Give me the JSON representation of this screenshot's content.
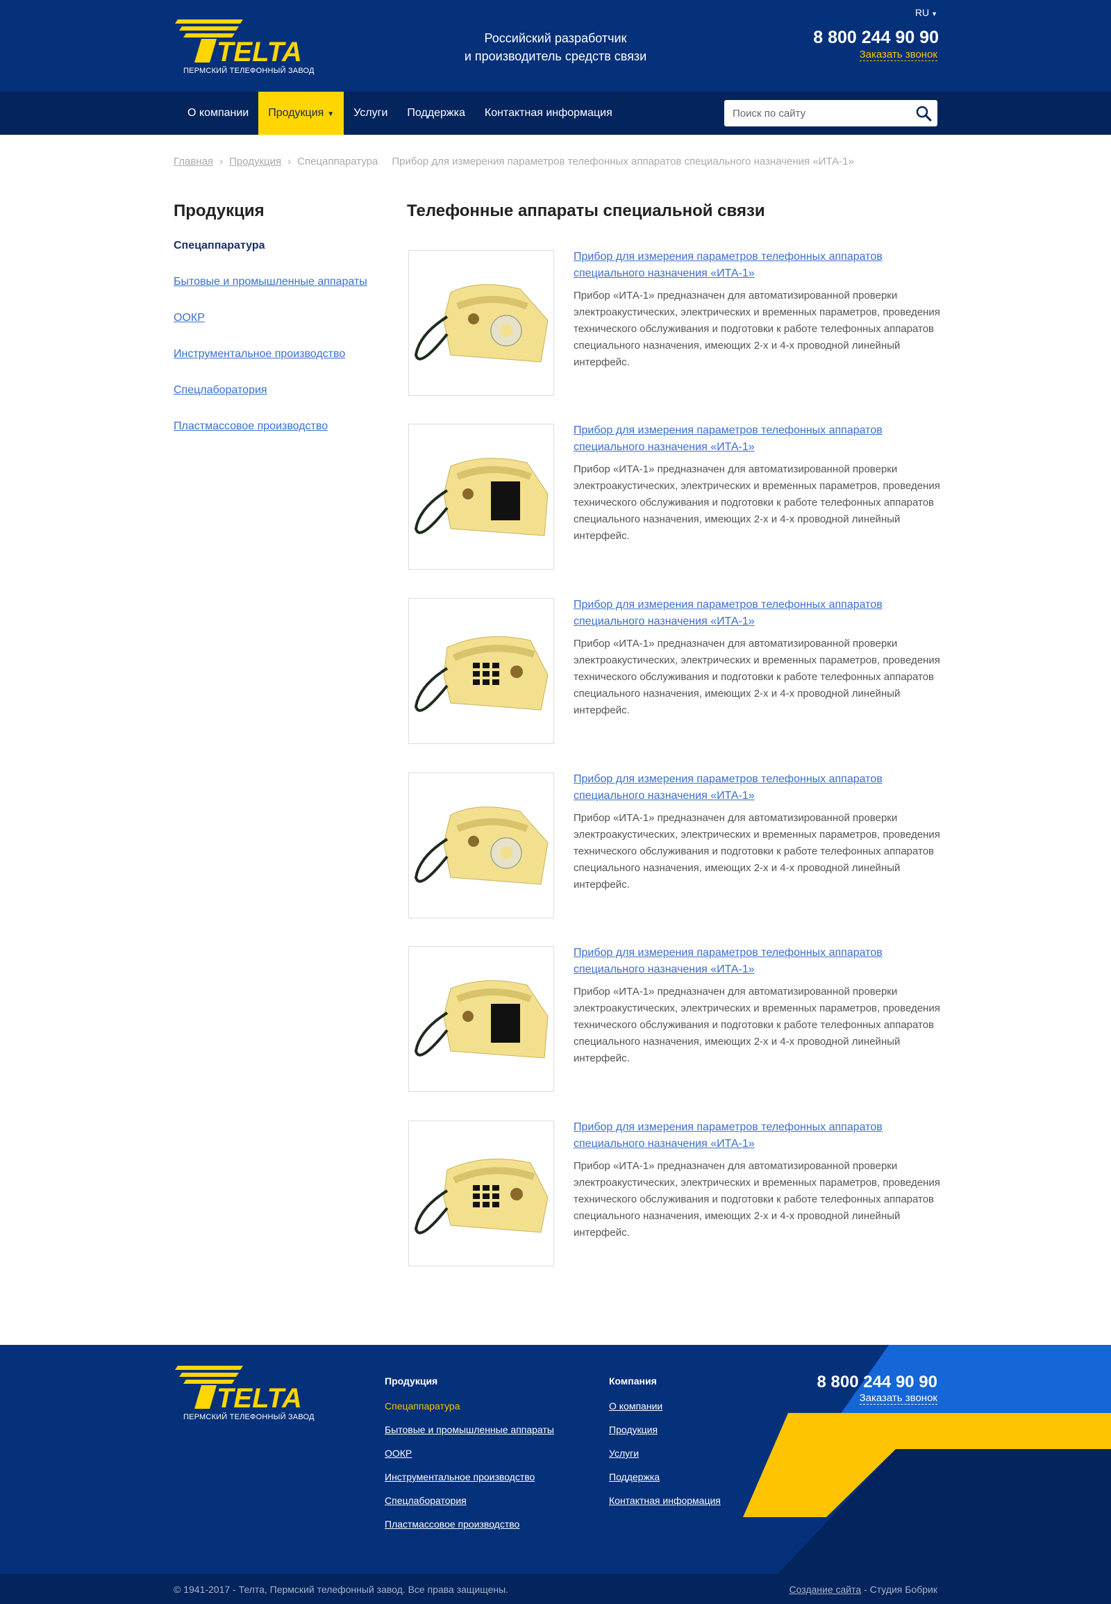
{
  "header": {
    "logo_text": "TELTA",
    "logo_sub": "ПЕРМСКИЙ ТЕЛЕФОННЫЙ ЗАВОД",
    "tagline_1": "Российский разработчик",
    "tagline_2": "и производитель средств связи",
    "lang": "RU",
    "phone": "8 800 244 90 90",
    "callback": "Заказать звонок"
  },
  "nav": {
    "items": [
      {
        "label": "О компании"
      },
      {
        "label": "Продукция"
      },
      {
        "label": "Услуги"
      },
      {
        "label": "Поддержка"
      },
      {
        "label": "Контактная информация"
      }
    ],
    "search_placeholder": "Поиск по сайту"
  },
  "breadcrumb": {
    "home": "Главная",
    "products": "Продукция",
    "section": "Спецаппаратура",
    "current": "Прибор для измерения параметров телефонных аппаратов специального назначения «ИТА-1»"
  },
  "sidebar": {
    "title": "Продукция",
    "items": [
      {
        "label": "Спецаппаратура"
      },
      {
        "label": "Бытовые и промышленные аппараты"
      },
      {
        "label": "ООКР"
      },
      {
        "label": "Инструментальное производство"
      },
      {
        "label": "Спецлаборатория"
      },
      {
        "label": "Пластмассовое производство"
      }
    ]
  },
  "main": {
    "title": "Телефонные аппараты специальной связи",
    "products": [
      {
        "link_1": "Прибор для измерения параметров телефонных аппаратов",
        "link_2": "специального назначения «ИТА-1»",
        "desc": "Прибор «ИТА-1» предназначен для автоматизированной проверки электроакустических, электрических и временных параметров, проведения технического обслуживания и подготовки к работе телефонных аппаратов специального назначения, имеющих 2-х и 4-х проводной линейный интерфейс."
      },
      {
        "link_1": "Прибор для измерения параметров телефонных аппаратов",
        "link_2": "специального назначения «ИТА-1»",
        "desc": "Прибор «ИТА-1» предназначен для автоматизированной проверки электроакустических, электрических и временных параметров, проведения технического обслуживания и подготовки к работе телефонных аппаратов специального назначения, имеющих 2-х и 4-х проводной линейный интерфейс."
      },
      {
        "link_1": "Прибор для измерения параметров телефонных аппаратов",
        "link_2": "специального назначения «ИТА-1»",
        "desc": "Прибор «ИТА-1» предназначен для автоматизированной проверки электроакустических, электрических и временных параметров, проведения технического обслуживания и подготовки к работе телефонных аппаратов специального назначения, имеющих 2-х и 4-х проводной линейный интерфейс."
      },
      {
        "link_1": "Прибор для измерения параметров телефонных аппаратов",
        "link_2": "специального назначения «ИТА-1»",
        "desc": "Прибор «ИТА-1» предназначен для автоматизированной проверки электроакустических, электрических и временных параметров, проведения технического обслуживания и подготовки к работе телефонных аппаратов специального назначения, имеющих 2-х и 4-х проводной линейный интерфейс."
      },
      {
        "link_1": "Прибор для измерения параметров телефонных аппаратов",
        "link_2": "специального назначения «ИТА-1»",
        "desc": "Прибор «ИТА-1» предназначен для автоматизированной проверки электроакустических, электрических и временных параметров, проведения технического обслуживания и подготовки к работе телефонных аппаратов специального назначения, имеющих 2-х и 4-х проводной линейный интерфейс."
      },
      {
        "link_1": "Прибор для измерения параметров телефонных аппаратов",
        "link_2": "специального назначения «ИТА-1»",
        "desc": "Прибор «ИТА-1» предназначен для автоматизированной проверки электроакустических, электрических и временных параметров, проведения технического обслуживания и подготовки к работе телефонных аппаратов специального назначения, имеющих 2-х и 4-х проводной линейный интерфейс."
      }
    ]
  },
  "footer": {
    "col1_title": "Продукция",
    "col1": [
      "Спецаппаратура",
      "Бытовые и промышленные аппараты",
      "ООКР",
      "Инструментальное производство",
      "Спецлаборатория",
      "Пластмассовое производство"
    ],
    "col2_title": "Компания",
    "col2": [
      "О компании",
      "Продукция",
      "Услуги",
      "Поддержка",
      "Контактная информация"
    ],
    "phone": "8 800 244 90 90",
    "callback": "Заказать звонок",
    "copyright": "© 1941-2017 - Телта, Пермский телефонный завод. Все права защищены.",
    "studio_link": "Создание сайта",
    "studio_text": " - Студия Бобрик"
  },
  "colors": {
    "brand_blue": "#05307a",
    "nav_dark": "#03245c",
    "accent_yellow": "#ffd600",
    "link": "#3a6fd0"
  }
}
